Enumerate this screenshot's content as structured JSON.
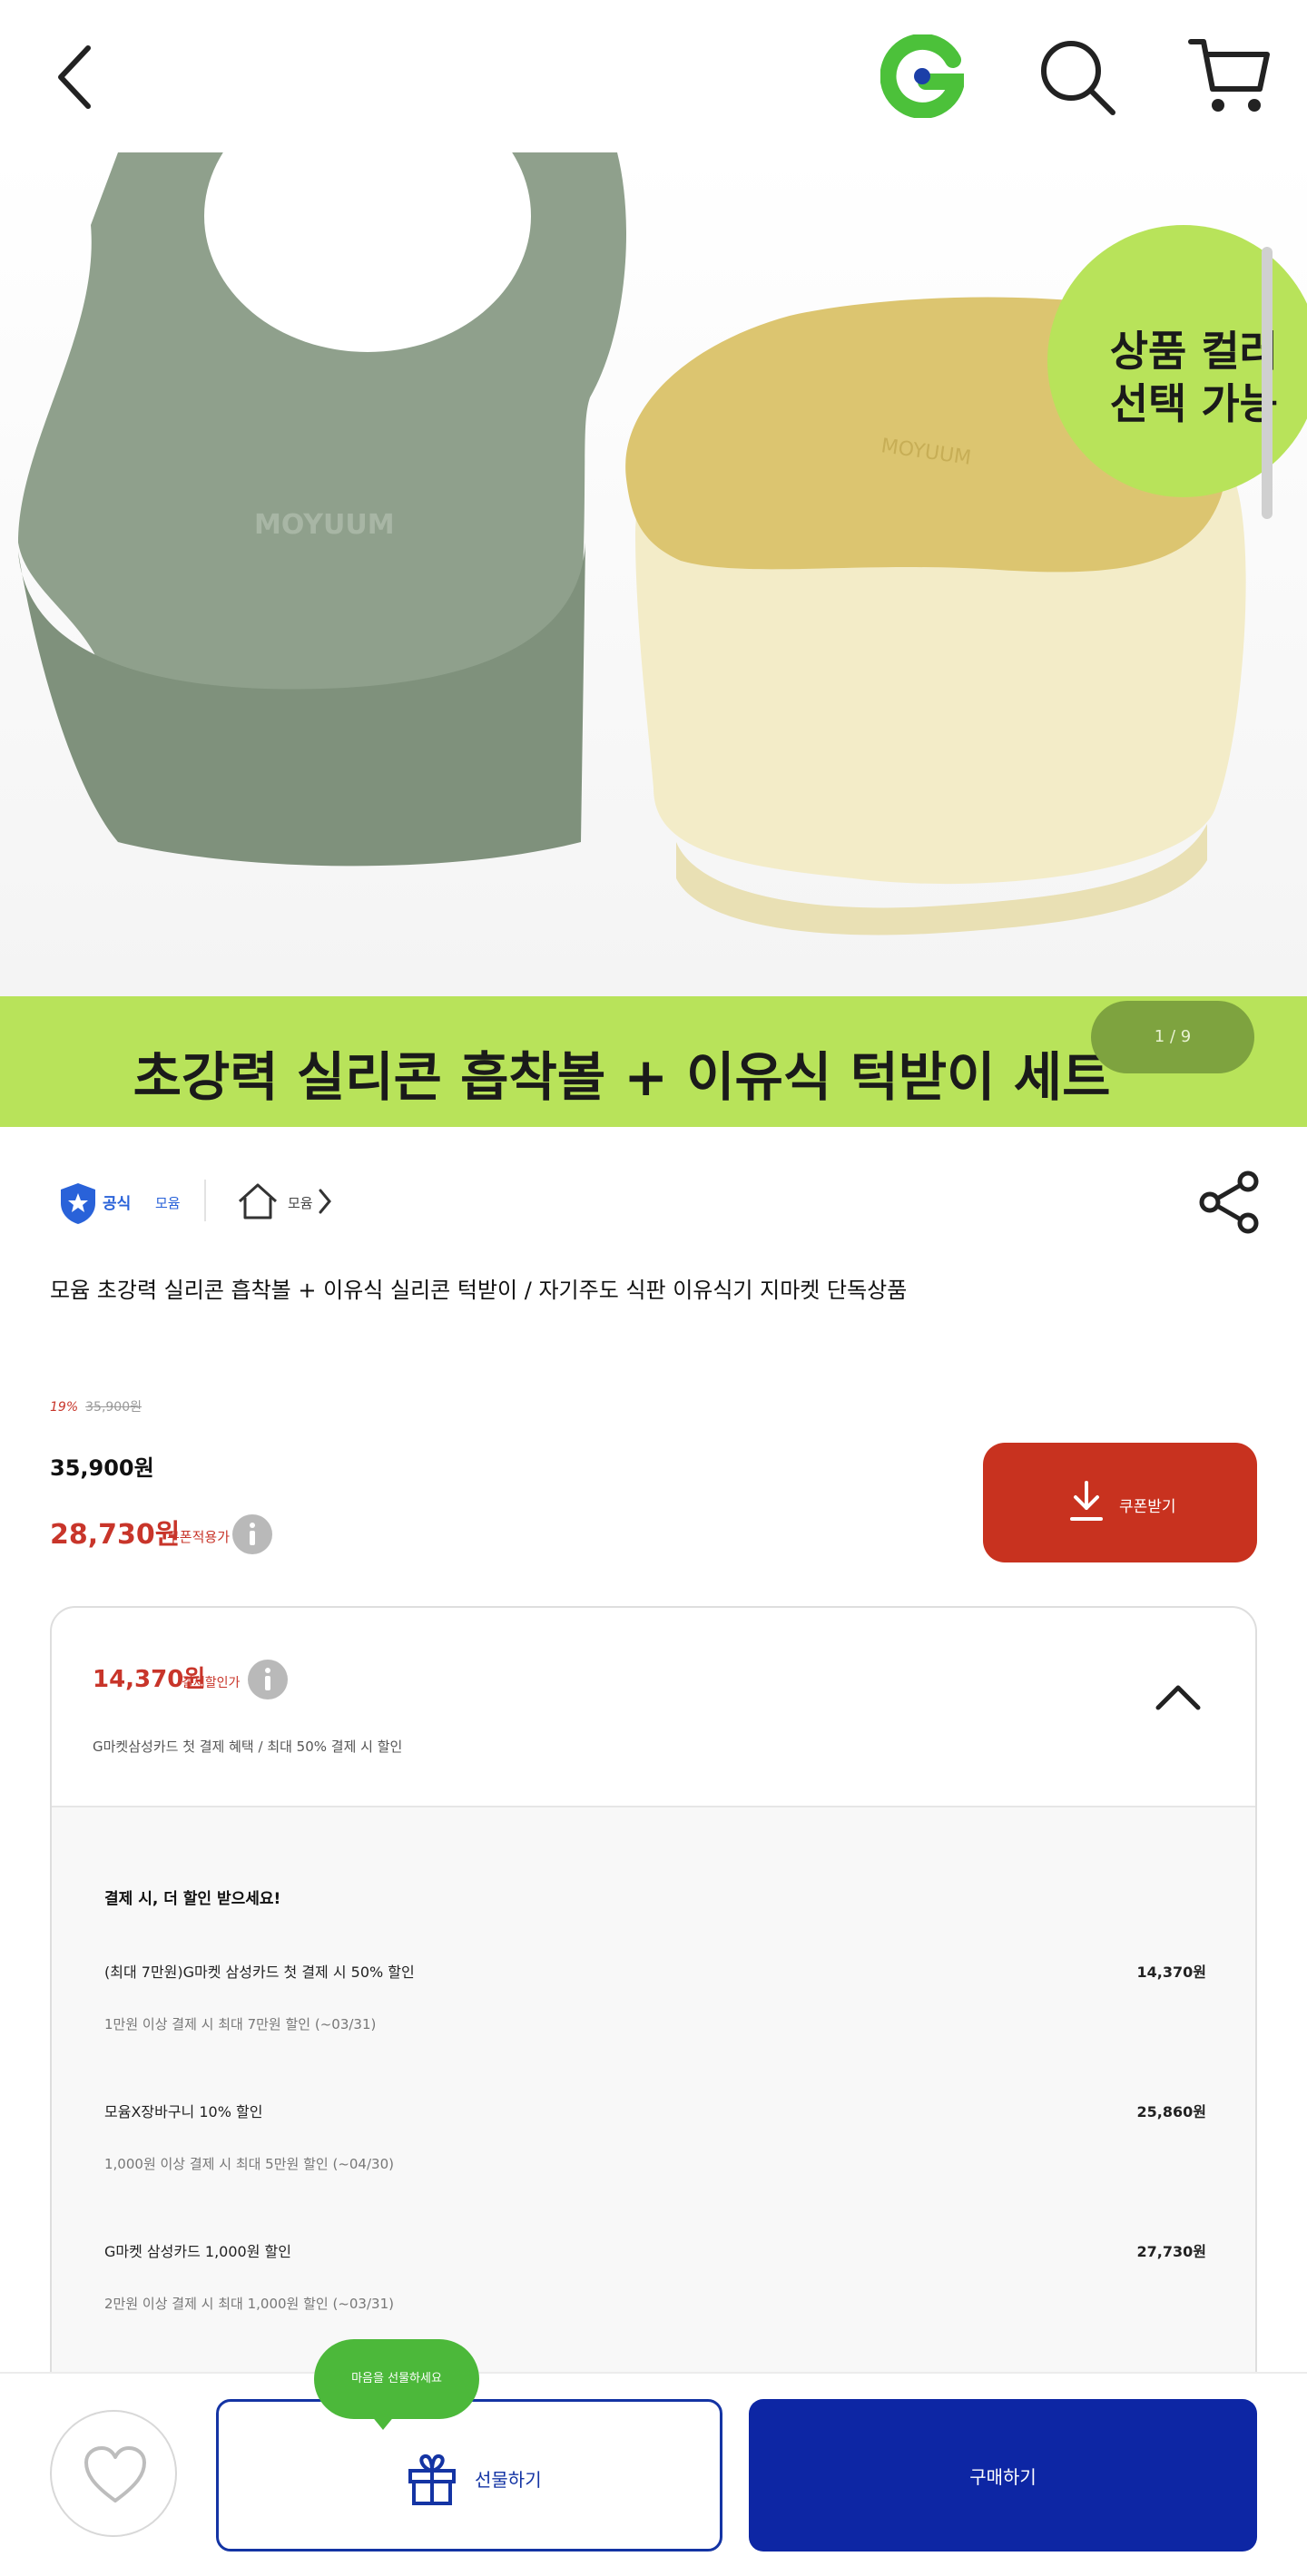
{
  "header": {
    "back_icon": "chevron-left-icon",
    "logo_icon": "gmarket-g-logo",
    "search_icon": "search-icon",
    "cart_icon": "cart-icon"
  },
  "hero": {
    "badge_text": "상품 컬러\n선택 가능",
    "banner_text": "초강력 실리콘 흡착볼 + 이유식 턱받이 세트",
    "pager": "1 / 9",
    "colors": {
      "badge": "#b8e35a",
      "bib": "#8fa08c",
      "lid": "#dcc570",
      "bowl": "#f3ecc8"
    }
  },
  "seller": {
    "official_label": "공식",
    "seller_name": "모윰",
    "home_label": "모윰"
  },
  "product": {
    "title": "모윰 초강력 실리콘 흡착볼 + 이유식 실리콘 턱받이 / 자기주도 식판 이유식기 지마켓 단독상품",
    "discount_rate": "19%",
    "original_price": "35,900원",
    "sale_price": "35,900원",
    "coupon_price": "28,730원",
    "coupon_price_label": "쿠폰적용가",
    "coupon_button_label": "쿠폰받기"
  },
  "payment": {
    "head_amount": "14,370원",
    "head_label": "결제할인가",
    "head_sub": "G마켓삼성카드 첫 결제 혜택 / 최대 50% 결제 시 할인",
    "body_title": "결제 시, 더 할인 받으세요!",
    "benefits": [
      {
        "name": "(최대 7만원)G마켓 삼성카드 첫 결제 시 50% 할인",
        "amount": "14,370원",
        "condition": "1만원 이상 결제 시 최대 7만원 할인 (~03/31)"
      },
      {
        "name": "모윰X장바구니 10% 할인",
        "amount": "25,860원",
        "condition": "1,000원 이상 결제 시 최대 5만원 할인 (~04/30)"
      },
      {
        "name": "G마켓 삼성카드 1,000원 할인",
        "amount": "27,730원",
        "condition": "2만원 이상 결제 시 최대 1,000원 할인 (~03/31)"
      }
    ]
  },
  "bottom": {
    "gift_tooltip": "마음을 선물하세요",
    "gift_label": "선물하기",
    "buy_label": "구매하기",
    "colors": {
      "buy": "#0d26a4",
      "coupon": "#c8321f",
      "tooltip": "#4cb83a"
    }
  }
}
